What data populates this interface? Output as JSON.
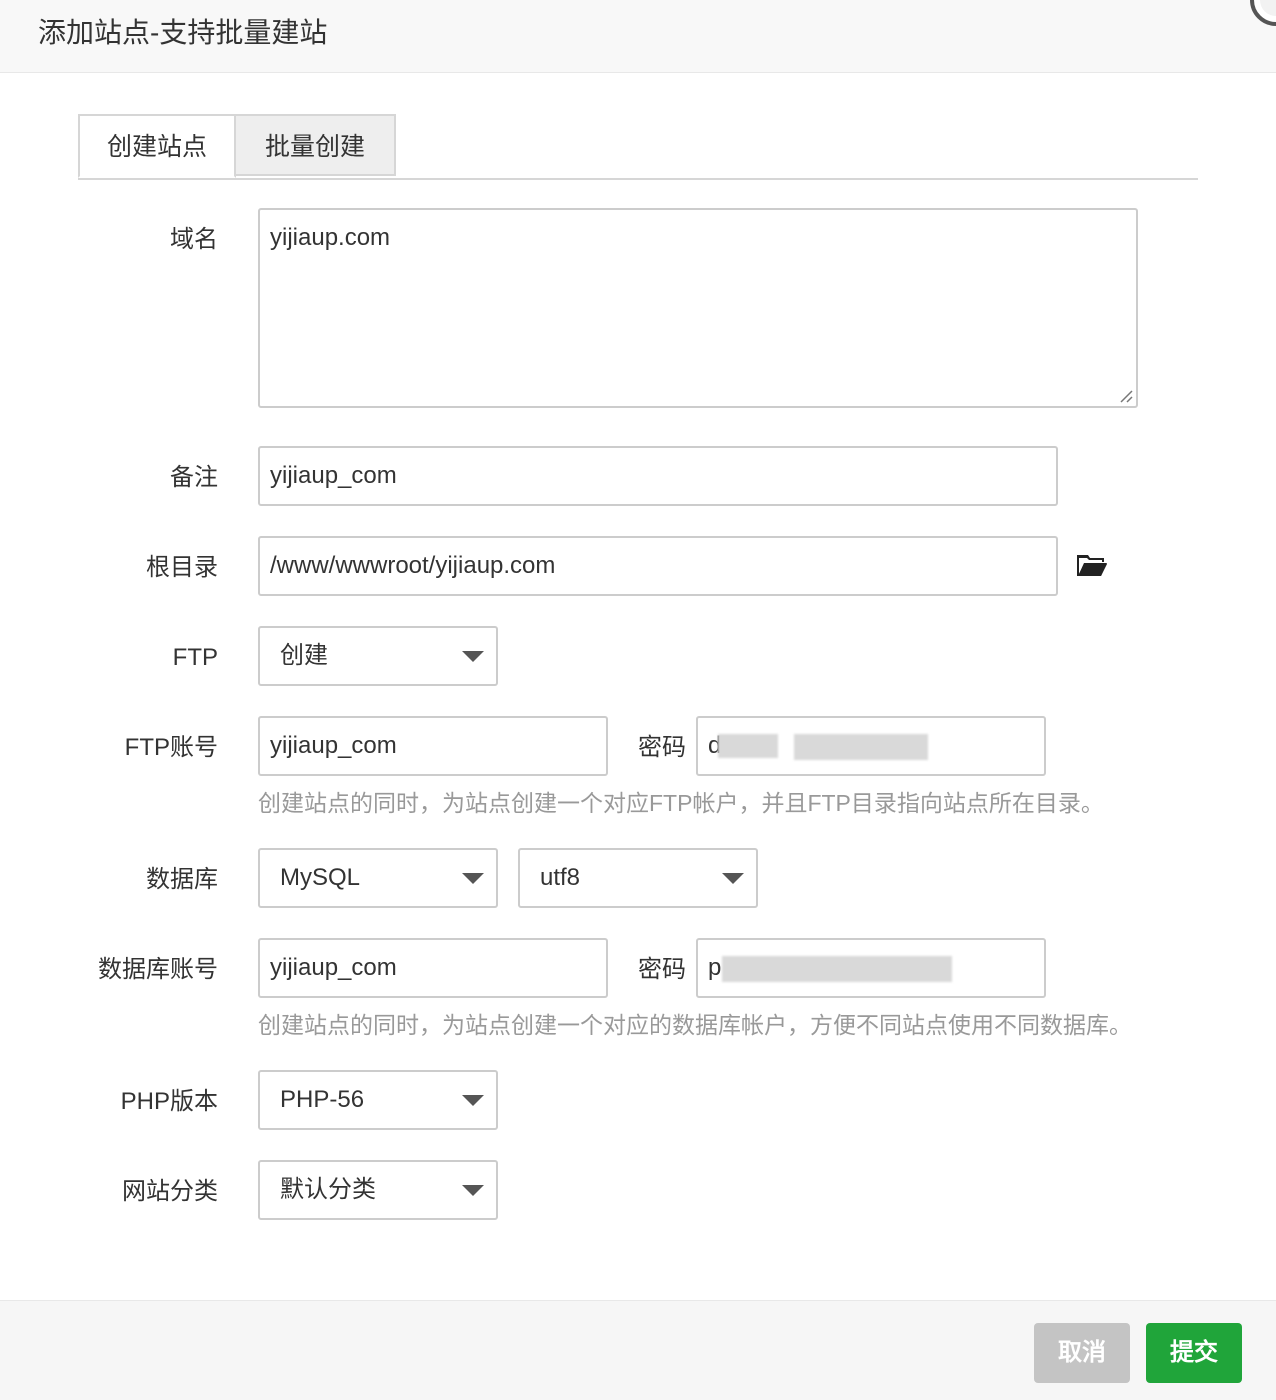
{
  "dialog": {
    "title": "添加站点-支持批量建站"
  },
  "tabs": [
    {
      "label": "创建站点",
      "active": true
    },
    {
      "label": "批量创建",
      "active": false
    }
  ],
  "form": {
    "domain": {
      "label": "域名",
      "value": "yijiaup.com"
    },
    "remark": {
      "label": "备注",
      "value": "yijiaup_com"
    },
    "root": {
      "label": "根目录",
      "value": "/www/wwwroot/yijiaup.com"
    },
    "ftp": {
      "label": "FTP",
      "selected": "创建"
    },
    "ftp_account": {
      "label": "FTP账号",
      "user": "yijiaup_com",
      "password_label": "密码",
      "password_prefix": "d",
      "hint": "创建站点的同时，为站点创建一个对应FTP帐户，并且FTP目录指向站点所在目录。"
    },
    "database": {
      "label": "数据库",
      "type_selected": "MySQL",
      "charset_selected": "utf8"
    },
    "db_account": {
      "label": "数据库账号",
      "user": "yijiaup_com",
      "password_label": "密码",
      "password_prefix": "p",
      "hint": "创建站点的同时，为站点创建一个对应的数据库帐户，方便不同站点使用不同数据库。"
    },
    "php": {
      "label": "PHP版本",
      "selected": "PHP-56"
    },
    "category": {
      "label": "网站分类",
      "selected": "默认分类"
    }
  },
  "footer": {
    "cancel_label": "取消",
    "submit_label": "提交"
  },
  "colors": {
    "submit": "#20a53a",
    "cancel": "#c4c4c4",
    "hint": "#999999",
    "border": "#cccccc"
  }
}
